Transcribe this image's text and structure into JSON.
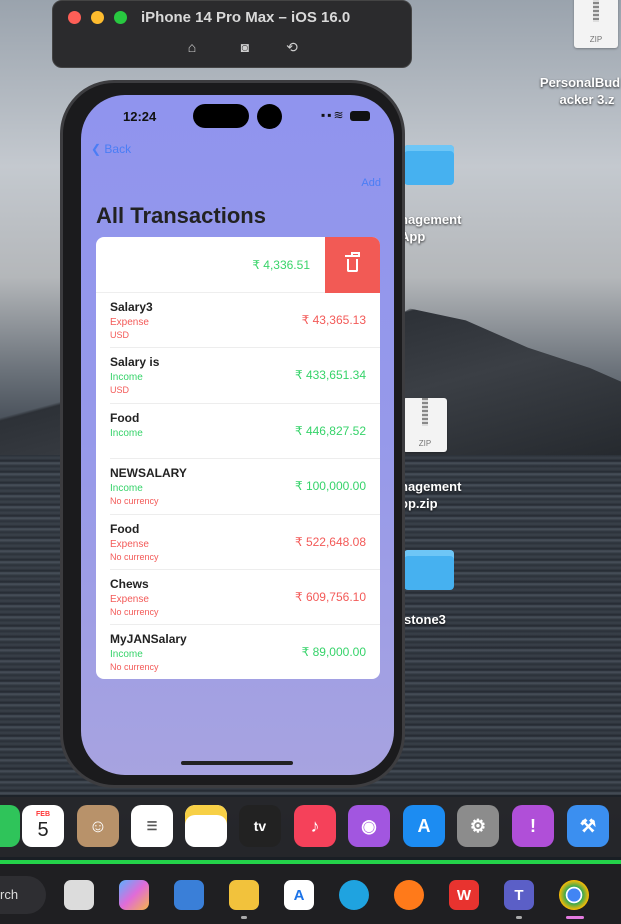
{
  "simulator": {
    "title": "iPhone 14 Pro Max – iOS 16.0",
    "home_icon": "home-icon",
    "screenshot_icon": "camera-icon",
    "rotate_icon": "rotate-icon"
  },
  "desktop": {
    "items": [
      {
        "label_line1": "PersonalBud",
        "label_line2": "acker 3.z",
        "kind": "zip",
        "zip_text": "ZIP"
      },
      {
        "label_line1": "nagement",
        "label_line2": "App",
        "kind": "folder"
      },
      {
        "label_line1": "nagement",
        "label_line2": "op.zip",
        "kind": "zip",
        "zip_text": "ZIP"
      },
      {
        "label_line1": "stone3",
        "label_line2": "",
        "kind": "folder"
      }
    ]
  },
  "phone": {
    "time": "12:24",
    "status_icons": "wifi battery",
    "back_label": "Back",
    "add_label": "Add",
    "title": "All Transactions",
    "swiped_row": {
      "amount": "₹ 4,336.51",
      "delete_icon": "trash-icon"
    },
    "transactions": [
      {
        "name": "Salary3",
        "type": "Expense",
        "currency": "USD",
        "amount": "₹ 43,365.13"
      },
      {
        "name": "Salary is",
        "type": "Income",
        "currency": "USD",
        "amount": "₹ 433,651.34"
      },
      {
        "name": "Food",
        "type": "Income",
        "currency": "",
        "amount": "₹ 446,827.52"
      },
      {
        "name": "NEWSALARY",
        "type": "Income",
        "currency": "No currency",
        "amount": "₹ 100,000.00"
      },
      {
        "name": "Food",
        "type": "Expense",
        "currency": "No currency",
        "amount": "₹ 522,648.08"
      },
      {
        "name": "Chews",
        "type": "Expense",
        "currency": "No currency",
        "amount": "₹ 609,756.10"
      },
      {
        "name": "MyJANSalary",
        "type": "Income",
        "currency": "No currency",
        "amount": "₹ 89,000.00"
      }
    ],
    "colors": {
      "income": "#36d36a",
      "expense": "#f35a58",
      "accent": "#4a7df5",
      "delete": "#f25a55"
    }
  },
  "dock": {
    "calendar_month": "FEB",
    "calendar_day": "5",
    "apps": [
      "calendar-icon",
      "contacts-icon",
      "reminders-icon",
      "notes-icon",
      "appletv-icon",
      "music-icon",
      "podcasts-icon",
      "appstore-icon",
      "system-settings-icon",
      "feedback-icon",
      "xcode-icon"
    ],
    "tv_label": "tv"
  },
  "taskbar": {
    "search_text": "rch",
    "apps": [
      "task-view-icon",
      "copilot-icon",
      "widgets-icon",
      "file-explorer-icon",
      "app-icon",
      "edge-icon",
      "firefox-icon",
      "wps-icon",
      "teams-icon",
      "chrome-icon"
    ]
  }
}
